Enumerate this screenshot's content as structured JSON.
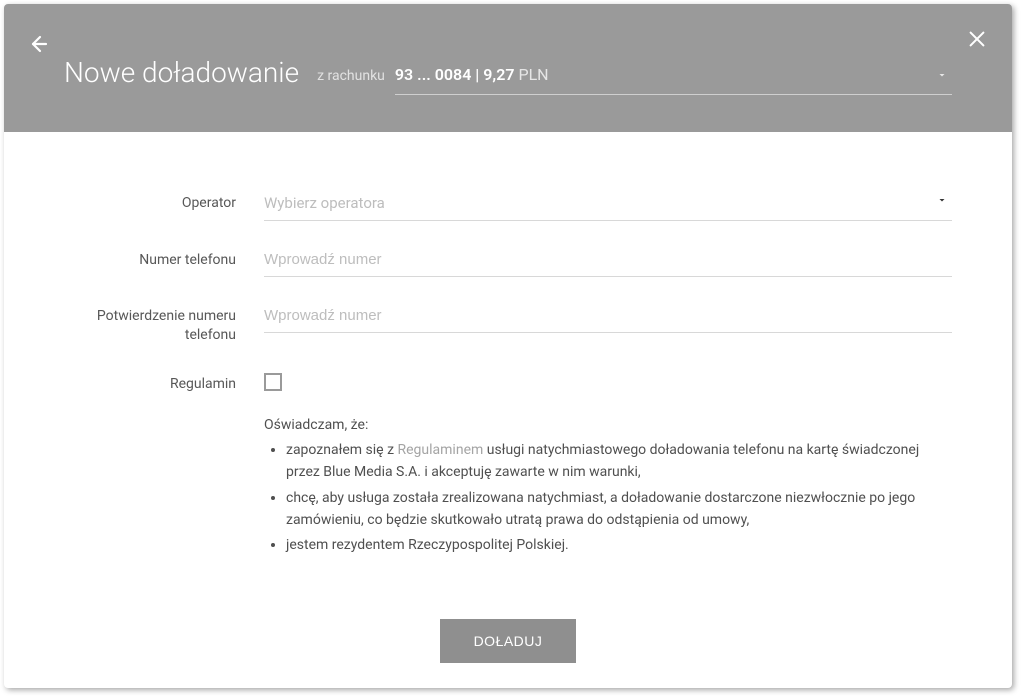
{
  "header": {
    "title": "Nowe doładowanie",
    "account_label": "z rachunku",
    "account_value": "93 ... 0084 | 9,27",
    "account_currency": "PLN"
  },
  "form": {
    "operator_label": "Operator",
    "operator_placeholder": "Wybierz operatora",
    "phone_label": "Numer telefonu",
    "phone_placeholder": "Wprowadź numer",
    "phone_confirm_label": "Potwierdzenie numeru telefonu",
    "phone_confirm_placeholder": "Wprowadź numer",
    "terms_label": "Regulamin",
    "declaration_intro": "Oświadczam, że:",
    "term1_before": "zapoznałem się z ",
    "term1_link": "Regulaminem",
    "term1_after": " usługi natychmiastowego doładowania telefonu na kartę świadczonej przez Blue Media S.A. i akceptuję zawarte w nim warunki,",
    "term2": "chcę, aby usługa została zrealizowana natychmiast, a doładowanie dostarczone niezwłocznie po jego zamówieniu, co będzie skutkowało utratą prawa do odstąpienia od umowy,",
    "term3": "jestem rezydentem Rzeczypospolitej Polskiej.",
    "submit_label": "DOŁADUJ"
  }
}
